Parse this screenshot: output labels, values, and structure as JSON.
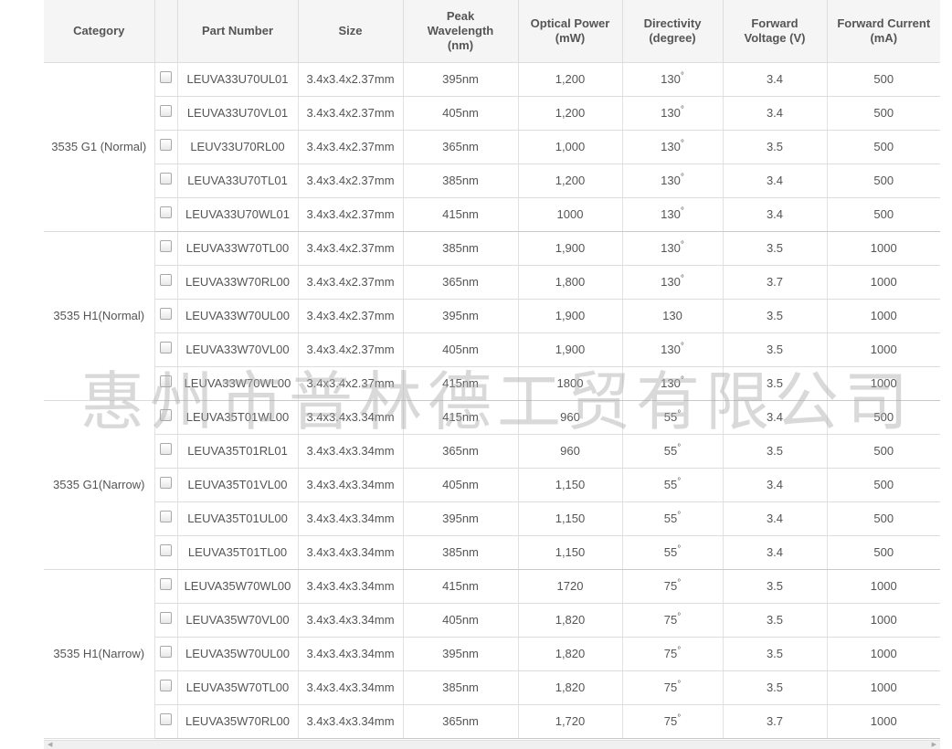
{
  "columns": [
    "Category",
    "",
    "Part Number",
    "Size",
    "Peak Wavelength (nm)",
    "Optical Power (mW)",
    "Directivity (degree)",
    "Forward Voltage (V)",
    "Forward Current (mA)"
  ],
  "header": {
    "category": "Category",
    "part_number": "Part Number",
    "size": "Size",
    "peak_l1": "Peak",
    "peak_l2": "Wavelength",
    "peak_l3": "(nm)",
    "optical_l1": "Optical Power",
    "optical_l2": "(mW)",
    "directivity_l1": "Directivity",
    "directivity_l2": "(degree)",
    "voltage_l1": "Forward",
    "voltage_l2": "Voltage (V)",
    "current_l1": "Forward Current",
    "current_l2": "(mA)"
  },
  "degree_symbol": "°",
  "groups": [
    {
      "category": "3535 G1 (Normal)",
      "rows": [
        {
          "part": "LEUVA33U70UL01",
          "size": "3.4x3.4x2.37mm",
          "wavelength": "395nm",
          "power": "1,200",
          "directivity": "130",
          "deg": true,
          "voltage": "3.4",
          "current": "500"
        },
        {
          "part": "LEUVA33U70VL01",
          "size": "3.4x3.4x2.37mm",
          "wavelength": "405nm",
          "power": "1,200",
          "directivity": "130",
          "deg": true,
          "voltage": "3.4",
          "current": "500"
        },
        {
          "part": "LEUV33U70RL00",
          "size": "3.4x3.4x2.37mm",
          "wavelength": "365nm",
          "power": "1,000",
          "directivity": "130",
          "deg": true,
          "voltage": "3.5",
          "current": "500"
        },
        {
          "part": "LEUVA33U70TL01",
          "size": "3.4x3.4x2.37mm",
          "wavelength": "385nm",
          "power": "1,200",
          "directivity": "130",
          "deg": true,
          "voltage": "3.4",
          "current": "500"
        },
        {
          "part": "LEUVA33U70WL01",
          "size": "3.4x3.4x2.37mm",
          "wavelength": "415nm",
          "power": "1000",
          "directivity": "130",
          "deg": true,
          "voltage": "3.4",
          "current": "500"
        }
      ]
    },
    {
      "category": "3535 H1(Normal)",
      "rows": [
        {
          "part": "LEUVA33W70TL00",
          "size": "3.4x3.4x2.37mm",
          "wavelength": "385nm",
          "power": "1,900",
          "directivity": "130",
          "deg": true,
          "voltage": "3.5",
          "current": "1000"
        },
        {
          "part": "LEUVA33W70RL00",
          "size": "3.4x3.4x2.37mm",
          "wavelength": "365nm",
          "power": "1,800",
          "directivity": "130",
          "deg": true,
          "voltage": "3.7",
          "current": "1000"
        },
        {
          "part": "LEUVA33W70UL00",
          "size": "3.4x3.4x2.37mm",
          "wavelength": "395nm",
          "power": "1,900",
          "directivity": "130",
          "deg": false,
          "voltage": "3.5",
          "current": "1000"
        },
        {
          "part": "LEUVA33W70VL00",
          "size": "3.4x3.4x2.37mm",
          "wavelength": "405nm",
          "power": "1,900",
          "directivity": "130",
          "deg": true,
          "voltage": "3.5",
          "current": "1000"
        },
        {
          "part": "LEUVA33W70WL00",
          "size": "3.4x3.4x2.37mm",
          "wavelength": "415nm",
          "power": "1800",
          "directivity": "130",
          "deg": true,
          "voltage": "3.5",
          "current": "1000"
        }
      ]
    },
    {
      "category": "3535 G1(Narrow)",
      "rows": [
        {
          "part": "LEUVA35T01WL00",
          "size": "3.4x3.4x3.34mm",
          "wavelength": "415nm",
          "power": "960",
          "directivity": "55",
          "deg": true,
          "voltage": "3.4",
          "current": "500"
        },
        {
          "part": "LEUVA35T01RL01",
          "size": "3.4x3.4x3.34mm",
          "wavelength": "365nm",
          "power": "960",
          "directivity": "55",
          "deg": true,
          "voltage": "3.5",
          "current": "500"
        },
        {
          "part": "LEUVA35T01VL00",
          "size": "3.4x3.4x3.34mm",
          "wavelength": "405nm",
          "power": "1,150",
          "directivity": "55",
          "deg": true,
          "voltage": "3.4",
          "current": "500"
        },
        {
          "part": "LEUVA35T01UL00",
          "size": "3.4x3.4x3.34mm",
          "wavelength": "395nm",
          "power": "1,150",
          "directivity": "55",
          "deg": true,
          "voltage": "3.4",
          "current": "500"
        },
        {
          "part": "LEUVA35T01TL00",
          "size": "3.4x3.4x3.34mm",
          "wavelength": "385nm",
          "power": "1,150",
          "directivity": "55",
          "deg": true,
          "voltage": "3.4",
          "current": "500"
        }
      ]
    },
    {
      "category": "3535 H1(Narrow)",
      "rows": [
        {
          "part": "LEUVA35W70WL00",
          "size": "3.4x3.4x3.34mm",
          "wavelength": "415nm",
          "power": "1720",
          "directivity": "75",
          "deg": true,
          "voltage": "3.5",
          "current": "1000"
        },
        {
          "part": "LEUVA35W70VL00",
          "size": "3.4x3.4x3.34mm",
          "wavelength": "405nm",
          "power": "1,820",
          "directivity": "75",
          "deg": true,
          "voltage": "3.5",
          "current": "1000"
        },
        {
          "part": "LEUVA35W70UL00",
          "size": "3.4x3.4x3.34mm",
          "wavelength": "395nm",
          "power": "1,820",
          "directivity": "75",
          "deg": true,
          "voltage": "3.5",
          "current": "1000"
        },
        {
          "part": "LEUVA35W70TL00",
          "size": "3.4x3.4x3.34mm",
          "wavelength": "385nm",
          "power": "1,820",
          "directivity": "75",
          "deg": true,
          "voltage": "3.5",
          "current": "1000"
        },
        {
          "part": "LEUVA35W70RL00",
          "size": "3.4x3.4x3.34mm",
          "wavelength": "365nm",
          "power": "1,720",
          "directivity": "75",
          "deg": true,
          "voltage": "3.7",
          "current": "1000"
        }
      ]
    }
  ],
  "watermark": "惠州市普林德工贸有限公司",
  "scrollbar": {
    "left_arrow": "◀",
    "right_arrow": "▶"
  }
}
